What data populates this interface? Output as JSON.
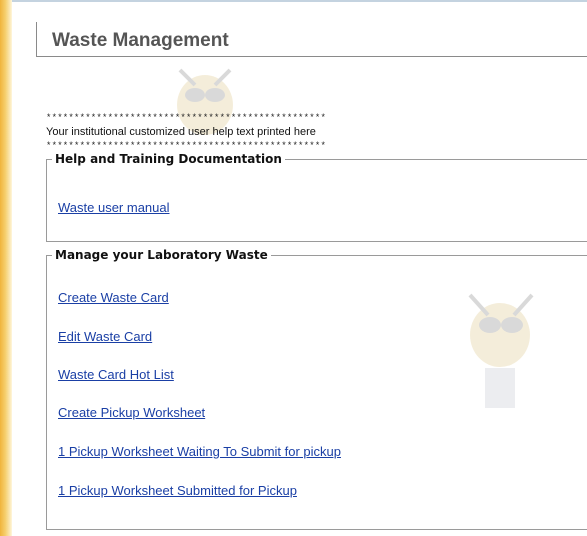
{
  "header": {
    "title": "Waste Management"
  },
  "banner": {
    "stars_top": "**************************************************",
    "help_text": "Your institutional customized user help text printed here",
    "stars_bottom": "**************************************************"
  },
  "help_section": {
    "legend": "Help and Training Documentation",
    "links": [
      "Waste user manual"
    ]
  },
  "manage_section": {
    "legend": "Manage your Laboratory Waste",
    "links": [
      "Create Waste Card",
      "Edit Waste Card",
      "Waste Card Hot List",
      "Create Pickup Worksheet",
      "1 Pickup Worksheet Waiting To Submit for pickup",
      "1 Pickup Worksheet Submitted for Pickup"
    ]
  },
  "colors": {
    "accent_bar": "#f6cf6e",
    "link": "#1a3fa5"
  }
}
